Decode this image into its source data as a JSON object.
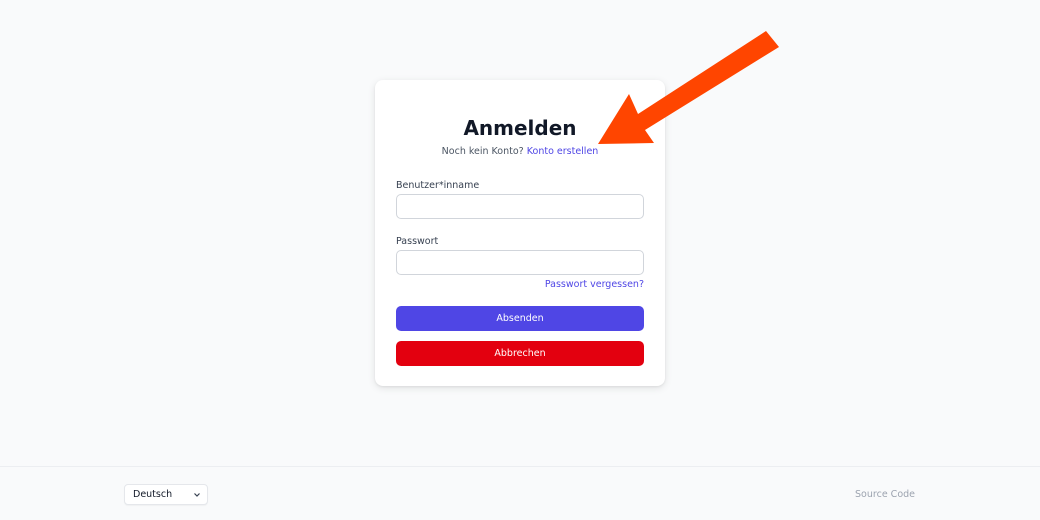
{
  "login": {
    "title": "Anmelden",
    "no_account_text": "Noch kein Konto?",
    "create_account_link": "Konto erstellen",
    "username_label": "Benutzer*inname",
    "username_value": "",
    "password_label": "Passwort",
    "password_value": "",
    "forgot_password_link": "Passwort vergessen?",
    "submit_label": "Absenden",
    "cancel_label": "Abbrechen"
  },
  "annotation": {
    "icon": "arrow-annotation-icon",
    "color": "#ff4500"
  },
  "footer": {
    "language_selected": "Deutsch",
    "source_code_link": "Source Code"
  },
  "colors": {
    "primary": "#4f46e5",
    "danger": "#e3000f",
    "background": "#f9fafb"
  }
}
